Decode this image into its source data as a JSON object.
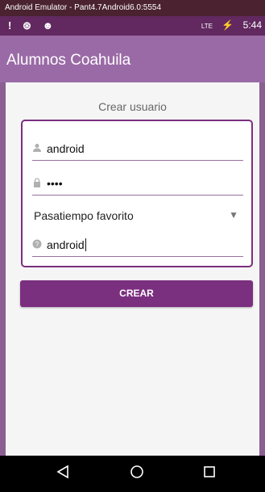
{
  "window": {
    "title": "Android Emulator - Pant4.7Android6.0:5554"
  },
  "statusbar": {
    "left_icons": [
      "!",
      "⊛",
      "☻"
    ],
    "right_signal": "LTE",
    "battery": "⚡",
    "time": "5:44"
  },
  "appbar": {
    "title": "Alumnos Coahuila"
  },
  "form": {
    "heading": "Crear usuario",
    "username": {
      "icon": "person-icon",
      "value": "android"
    },
    "password": {
      "icon": "lock-icon",
      "value": "••••"
    },
    "hobby": {
      "selected": "Pasatiempo favorito"
    },
    "hint_field": {
      "icon": "help-icon",
      "value": "android"
    },
    "submit_label": "CREAR"
  },
  "colors": {
    "primary": "#7b2f7f",
    "primary_dark": "#61295f",
    "appbar": "#9a6aa6",
    "window_title": "#4a2230"
  }
}
